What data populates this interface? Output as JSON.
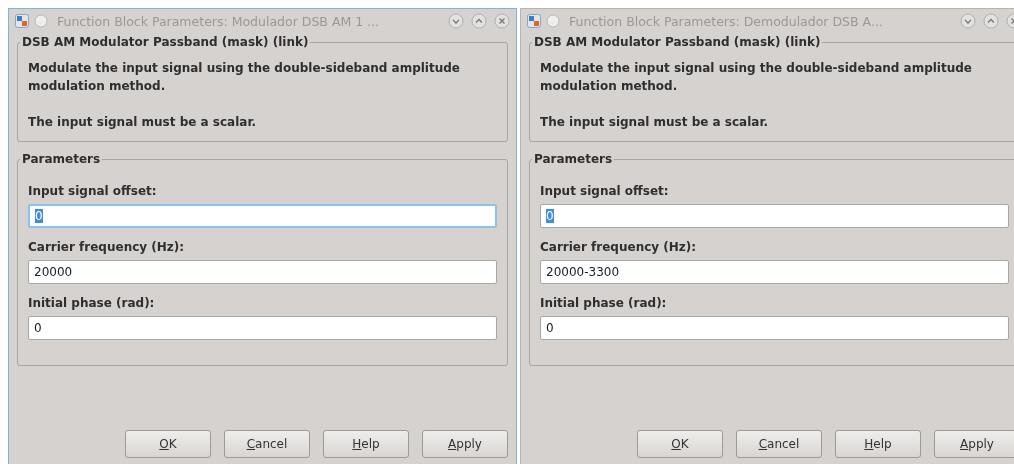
{
  "windows": [
    {
      "title": "Function Block Parameters: Modulador DSB AM 1 ...",
      "active": true,
      "block_title": "DSB AM Modulator Passband (mask) (link)",
      "description": [
        "Modulate the input signal using the double-sideband amplitude modulation method.",
        "The input signal must be a scalar."
      ],
      "parameters_title": "Parameters",
      "parameters": [
        {
          "label": "Input signal offset:",
          "value": "0",
          "focused": true,
          "text_selected": true
        },
        {
          "label": "Carrier frequency (Hz):",
          "value": "20000",
          "focused": false,
          "text_selected": false
        },
        {
          "label": "Initial phase (rad):",
          "value": "0",
          "focused": false,
          "text_selected": false
        }
      ],
      "buttons": [
        {
          "underlined": "O",
          "rest": "K"
        },
        {
          "underlined": "C",
          "rest": "ancel"
        },
        {
          "underlined": "H",
          "rest": "elp"
        },
        {
          "underlined": "A",
          "rest": "pply"
        }
      ]
    },
    {
      "title": "Function Block Parameters: Demodulador DSB A...",
      "active": false,
      "block_title": "DSB AM Modulator Passband (mask) (link)",
      "description": [
        "Modulate the input signal using the double-sideband amplitude modulation method.",
        "The input signal must be a scalar."
      ],
      "parameters_title": "Parameters",
      "parameters": [
        {
          "label": "Input signal offset:",
          "value": "0",
          "focused": false,
          "text_selected": true
        },
        {
          "label": "Carrier frequency (Hz):",
          "value": "20000-3300",
          "focused": false,
          "text_selected": false
        },
        {
          "label": "Initial phase (rad):",
          "value": "0",
          "focused": false,
          "text_selected": false
        }
      ],
      "buttons": [
        {
          "underlined": "O",
          "rest": "K"
        },
        {
          "underlined": "C",
          "rest": "ancel"
        },
        {
          "underlined": "H",
          "rest": "elp"
        },
        {
          "underlined": "A",
          "rest": "pply"
        }
      ]
    }
  ]
}
